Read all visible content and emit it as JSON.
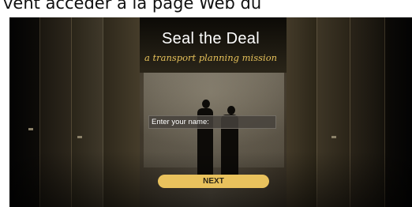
{
  "header_text": "vent accéder à la page Web du",
  "page": {
    "title": "Seal the Deal",
    "subtitle": "a transport planning mission"
  },
  "form": {
    "name_placeholder": "Enter your name:",
    "name_value": ""
  },
  "buttons": {
    "next_label": "NEXT"
  },
  "colors": {
    "accent": "#e9c25d",
    "title": "#ffffff",
    "subtitle": "#e6c15a"
  }
}
